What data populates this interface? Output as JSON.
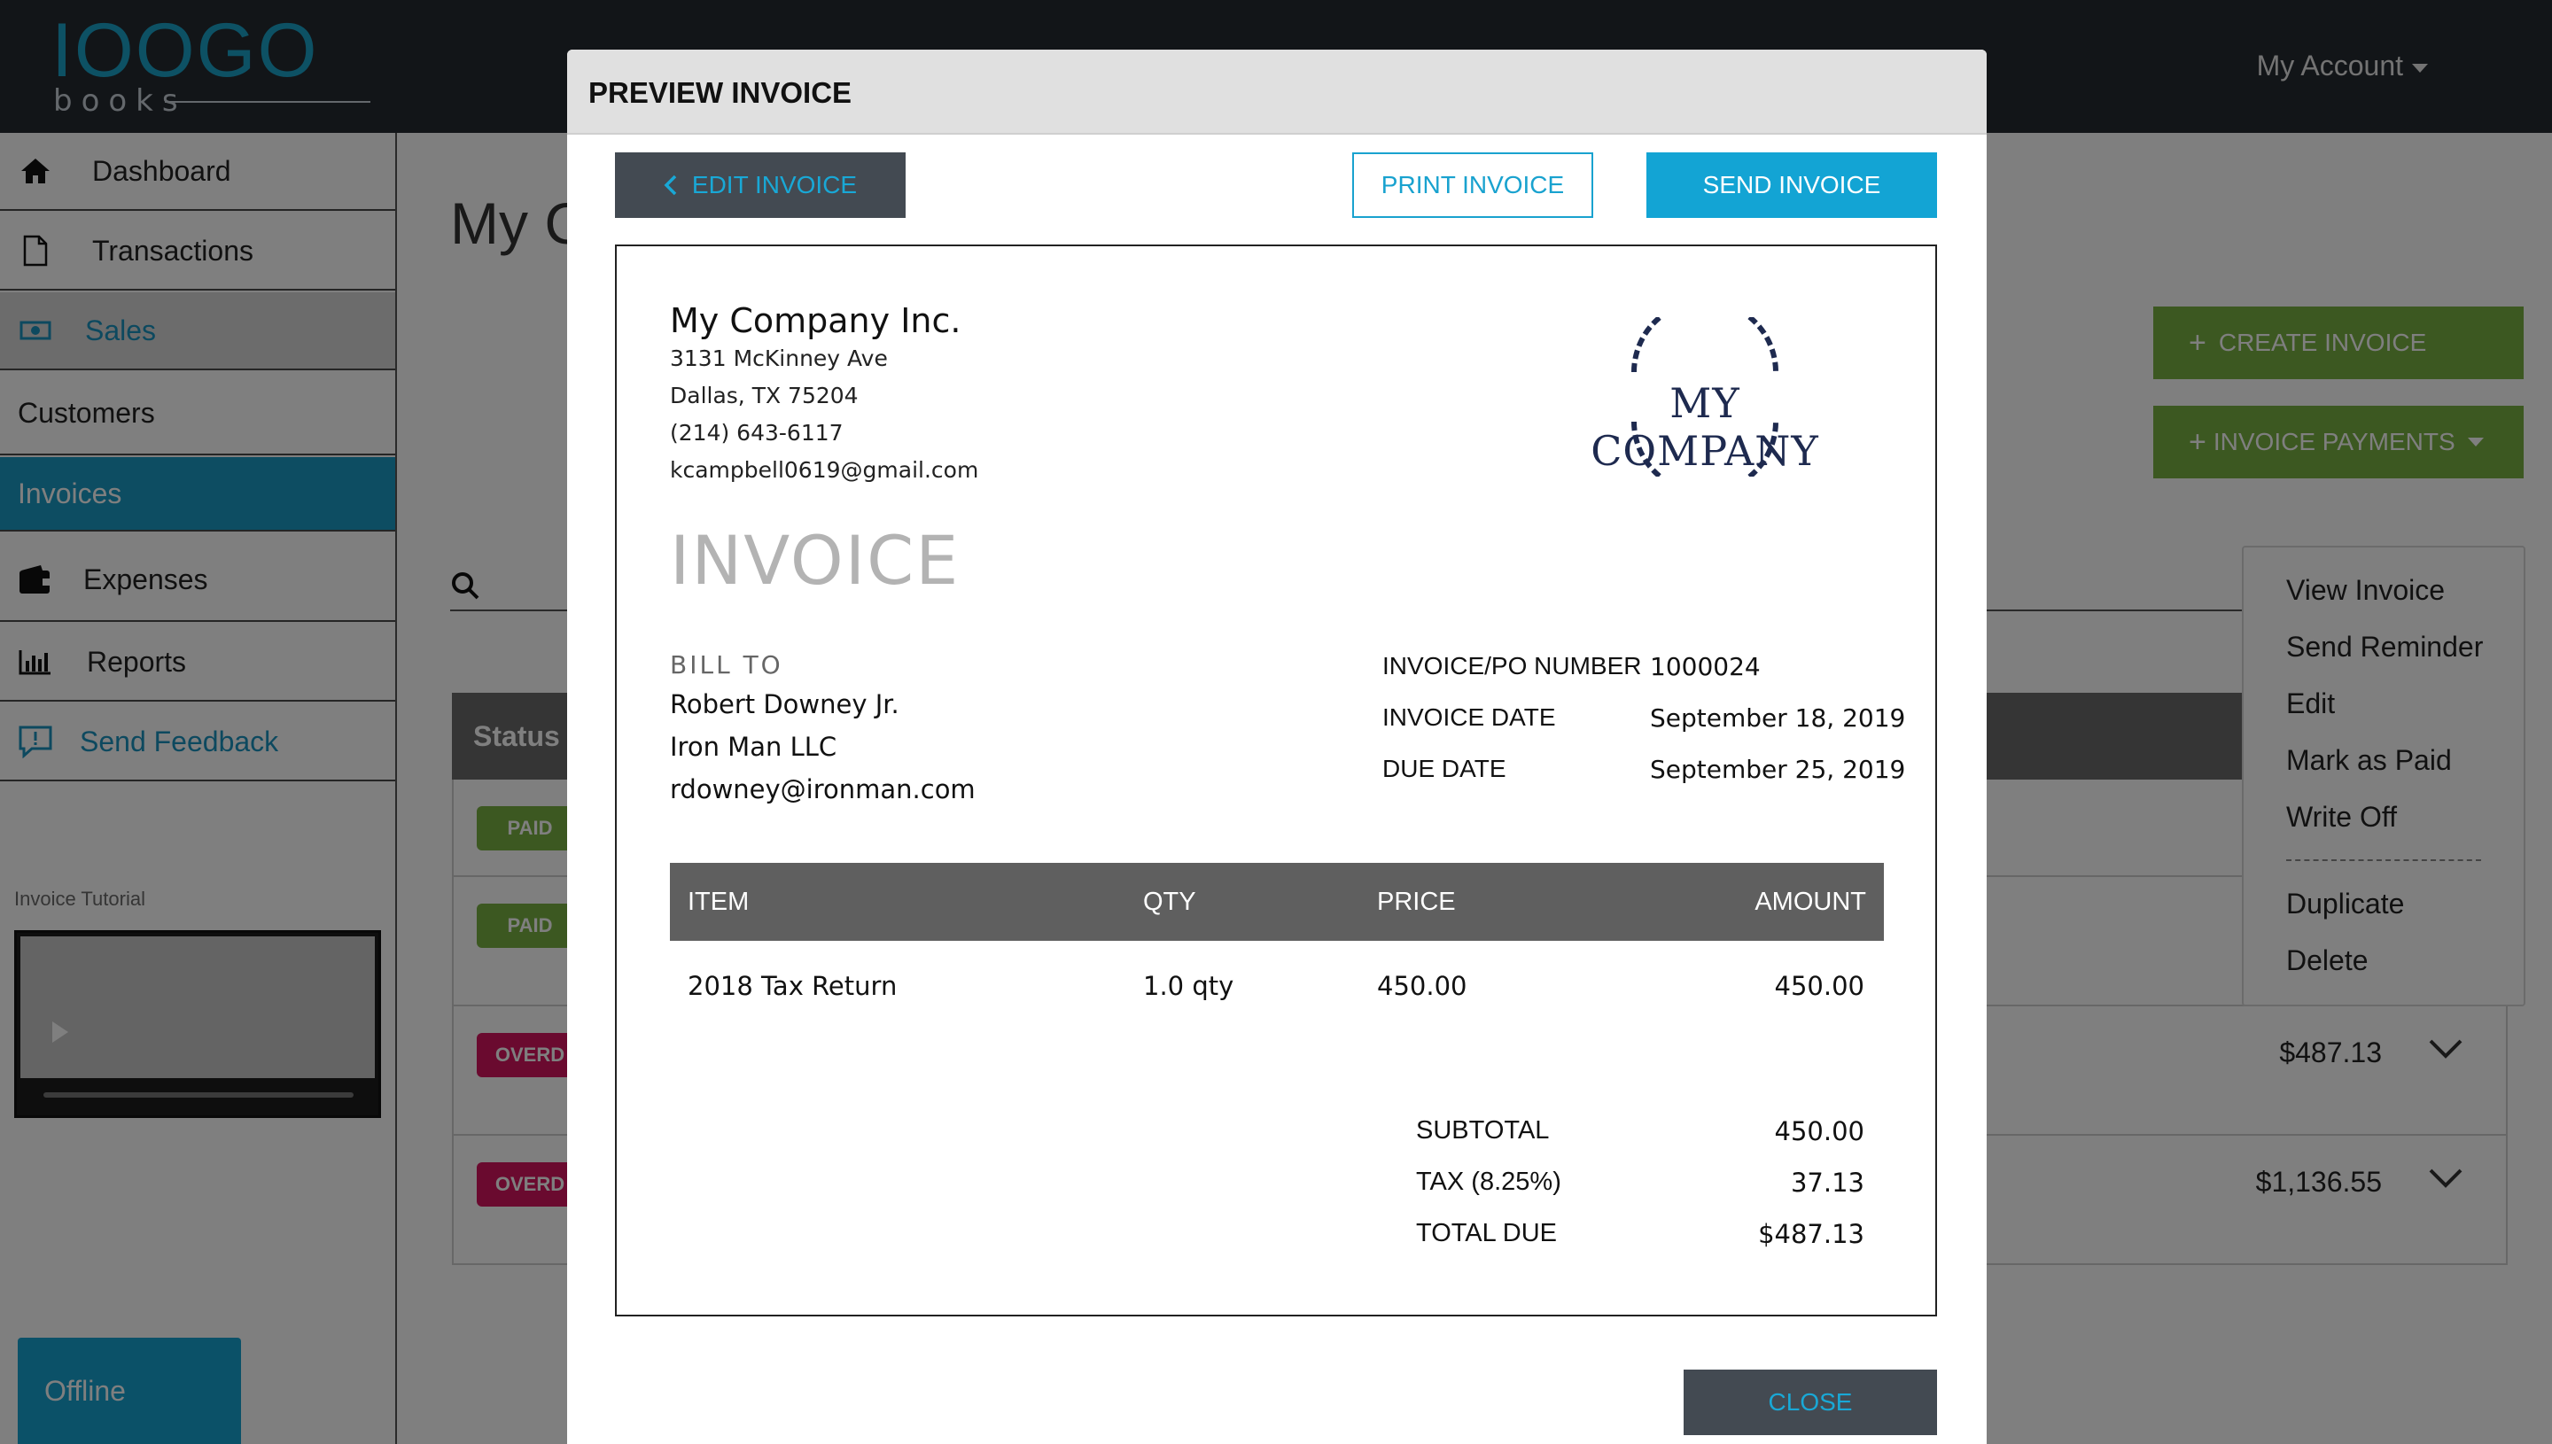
{
  "app": {
    "logo_main": "IOOGO",
    "logo_sub": "books",
    "account_label": "My Account"
  },
  "sidebar": {
    "items": [
      {
        "label": "Dashboard",
        "icon": "home-icon"
      },
      {
        "label": "Transactions",
        "icon": "document-icon"
      },
      {
        "label": "Sales",
        "icon": "money-icon"
      },
      {
        "label": "Customers"
      },
      {
        "label": "Invoices"
      },
      {
        "label": "Expenses",
        "icon": "wallet-icon"
      },
      {
        "label": "Reports",
        "icon": "bar-chart-icon"
      },
      {
        "label": "Send Feedback",
        "icon": "feedback-icon"
      }
    ],
    "tutorial_label": "Invoice Tutorial",
    "offline_label": "Offline"
  },
  "main": {
    "title": "My C",
    "create_invoice": "CREATE INVOICE",
    "invoice_payments": "INVOICE PAYMENTS",
    "table_status_header": "Status",
    "rows": [
      {
        "badge": "PAID",
        "amount": ""
      },
      {
        "badge": "PAID",
        "amount": ""
      },
      {
        "badge": "OVERD",
        "amount": "$487.13"
      },
      {
        "badge": "OVERD",
        "amount": "$1,136.55"
      }
    ],
    "menu": [
      "View Invoice",
      "Send Reminder",
      "Edit",
      "Mark as Paid",
      "Write Off",
      "Duplicate",
      "Delete"
    ]
  },
  "modal": {
    "title": "PREVIEW INVOICE",
    "edit_label": "EDIT INVOICE",
    "print_label": "PRINT INVOICE",
    "send_label": "SEND INVOICE",
    "close_label": "CLOSE"
  },
  "invoice": {
    "company_name": "My Company Inc.",
    "address1": "3131 McKinney Ave",
    "address2": "Dallas, TX 75204",
    "phone": "(214) 643-6117",
    "email": "kcampbell0619@gmail.com",
    "logo_text": "MY COMPANY",
    "heading": "INVOICE",
    "bill_to_label": "BILL TO",
    "customer_name": "Robert Downey Jr.",
    "customer_company": "Iron Man LLC",
    "customer_email": "rdowney@ironman.com",
    "number_label": "INVOICE/PO NUMBER",
    "number": "1000024",
    "date_label": "INVOICE DATE",
    "date": "September 18, 2019",
    "due_label": "DUE DATE",
    "due": "September 25, 2019",
    "columns": {
      "item": "ITEM",
      "qty": "QTY",
      "price": "PRICE",
      "amount": "AMOUNT"
    },
    "line_item": {
      "item": "2018 Tax Return",
      "qty": "1.0 qty",
      "price": "450.00",
      "amount": "450.00"
    },
    "subtotal_label": "SUBTOTAL",
    "subtotal": "450.00",
    "tax_label": "TAX (8.25%)",
    "tax": "37.13",
    "total_label": "TOTAL DUE",
    "total": "$487.13"
  },
  "colors": {
    "accent": "#1b9bc4",
    "green": "#79b142",
    "overdue": "#d4155e",
    "topbar": "#252a31",
    "logo_navy": "#1e2a4f"
  }
}
